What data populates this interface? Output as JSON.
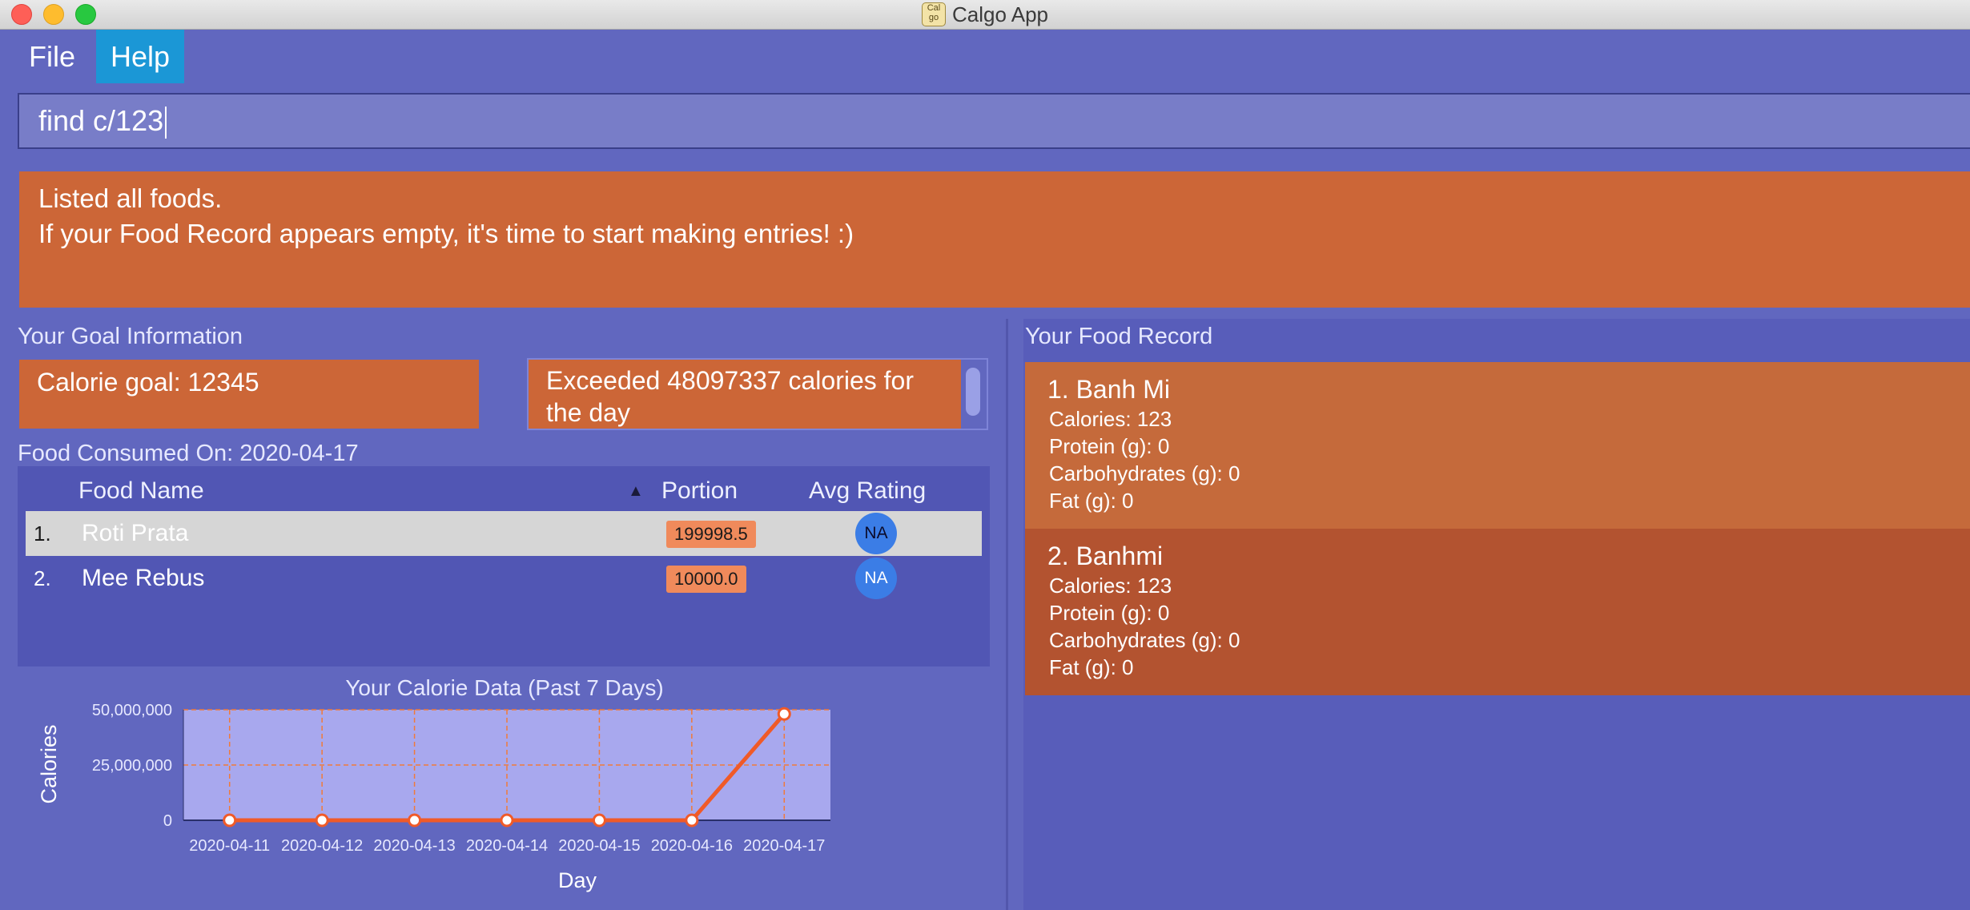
{
  "window": {
    "title": "Calgo App",
    "icon_text": "Cal go"
  },
  "menu": {
    "file": "File",
    "help": "Help"
  },
  "command": {
    "value": "find c/123"
  },
  "result": {
    "line1": "Listed all foods.",
    "line2": "If your Food Record appears empty, it's time to start making entries! :)"
  },
  "goal": {
    "section_title": "Your Goal Information",
    "calorie_goal": "Calorie goal: 12345",
    "exceeded": "Exceeded 48097337 calories for the day"
  },
  "consumed": {
    "title": "Food Consumed On: 2020-04-17",
    "headers": {
      "name": "Food Name",
      "sort_icon": "▲",
      "portion": "Portion",
      "rating": "Avg Rating"
    },
    "rows": [
      {
        "index": "1.",
        "name": "Roti Prata",
        "portion": "199998.5",
        "rating": "NA"
      },
      {
        "index": "2.",
        "name": "Mee Rebus",
        "portion": "10000.0",
        "rating": "NA"
      }
    ]
  },
  "chart_data": {
    "type": "line",
    "title": "Your Calorie Data (Past 7 Days)",
    "xlabel": "Day",
    "ylabel": "Calories",
    "categories": [
      "2020-04-11",
      "2020-04-12",
      "2020-04-13",
      "2020-04-14",
      "2020-04-15",
      "2020-04-16",
      "2020-04-17"
    ],
    "values": [
      0,
      0,
      0,
      0,
      0,
      0,
      48109682
    ],
    "ylim": [
      0,
      50000000
    ],
    "yticks": [
      0,
      25000000,
      50000000
    ],
    "ytick_labels": [
      "0",
      "25,000,000",
      "50,000,000"
    ],
    "grid": true,
    "colors": {
      "line": "#f05a28",
      "plot_bg": "#a8a8ee",
      "grid": "#f07a3a"
    }
  },
  "food_record": {
    "title": "Your Food Record",
    "items": [
      {
        "title": "1.  Banh Mi",
        "calories": "Calories: 123",
        "protein": "Protein (g): 0",
        "carbs": "Carbohydrates (g): 0",
        "fat": "Fat (g): 0"
      },
      {
        "title": "2.  Banhmi",
        "calories": "Calories: 123",
        "protein": "Protein (g): 0",
        "carbs": "Carbohydrates (g): 0",
        "fat": "Fat (g): 0"
      }
    ]
  }
}
